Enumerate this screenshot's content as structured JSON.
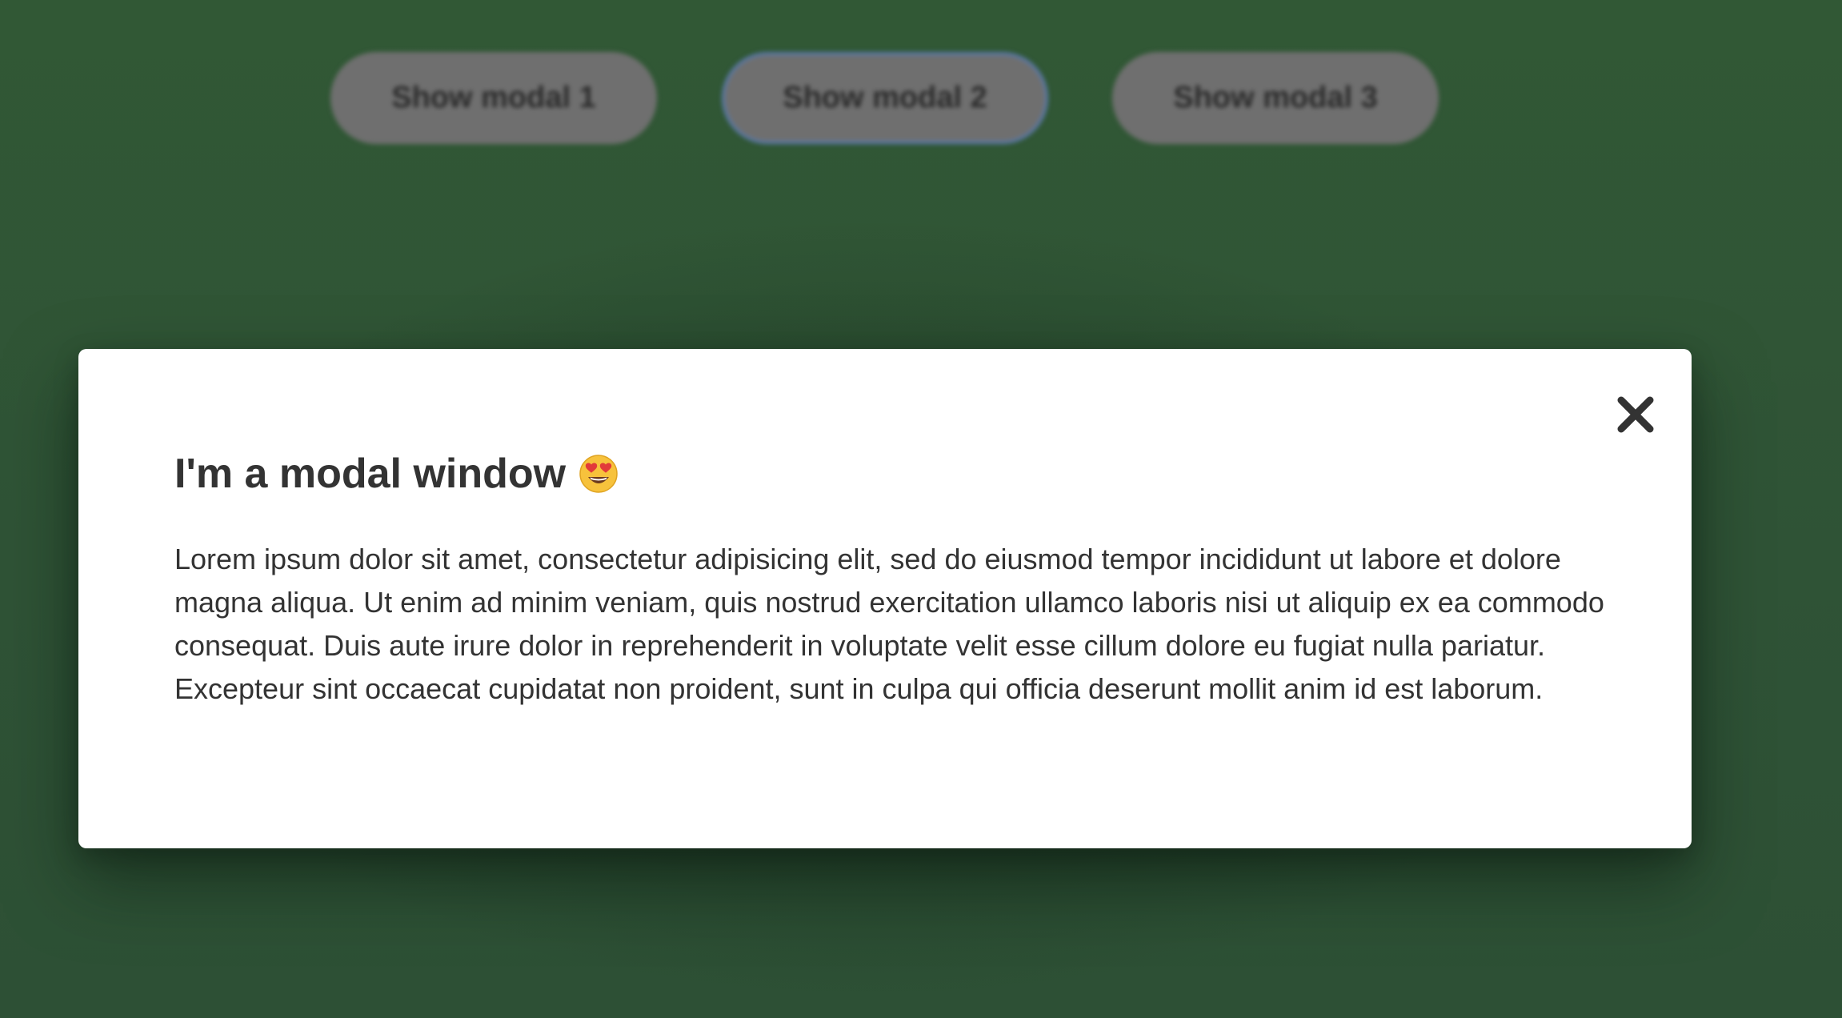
{
  "background": {
    "color": "#305436"
  },
  "buttons": [
    {
      "label": "Show modal 1"
    },
    {
      "label": "Show modal 2"
    },
    {
      "label": "Show modal 3"
    }
  ],
  "modal": {
    "title": "I'm a modal window",
    "emoji_icon": "heart-eyes-emoji-icon",
    "close_icon": "close-icon",
    "body": "Lorem ipsum dolor sit amet, consectetur adipisicing elit, sed do eiusmod tempor incididunt ut labore et dolore magna aliqua. Ut enim ad minim veniam, quis nostrud exercitation ullamco laboris nisi ut aliquip ex ea commodo consequat. Duis aute irure dolor in reprehenderit in voluptate velit esse cillum dolore eu fugiat nulla pariatur. Excepteur sint occaecat cupidatat non proident, sunt in culpa qui officia deserunt mollit anim id est laborum."
  },
  "colors": {
    "text": "#333333",
    "modal_bg": "#ffffff",
    "button_bg": "#6f6f6f",
    "focus_ring": "#5a78a8"
  }
}
